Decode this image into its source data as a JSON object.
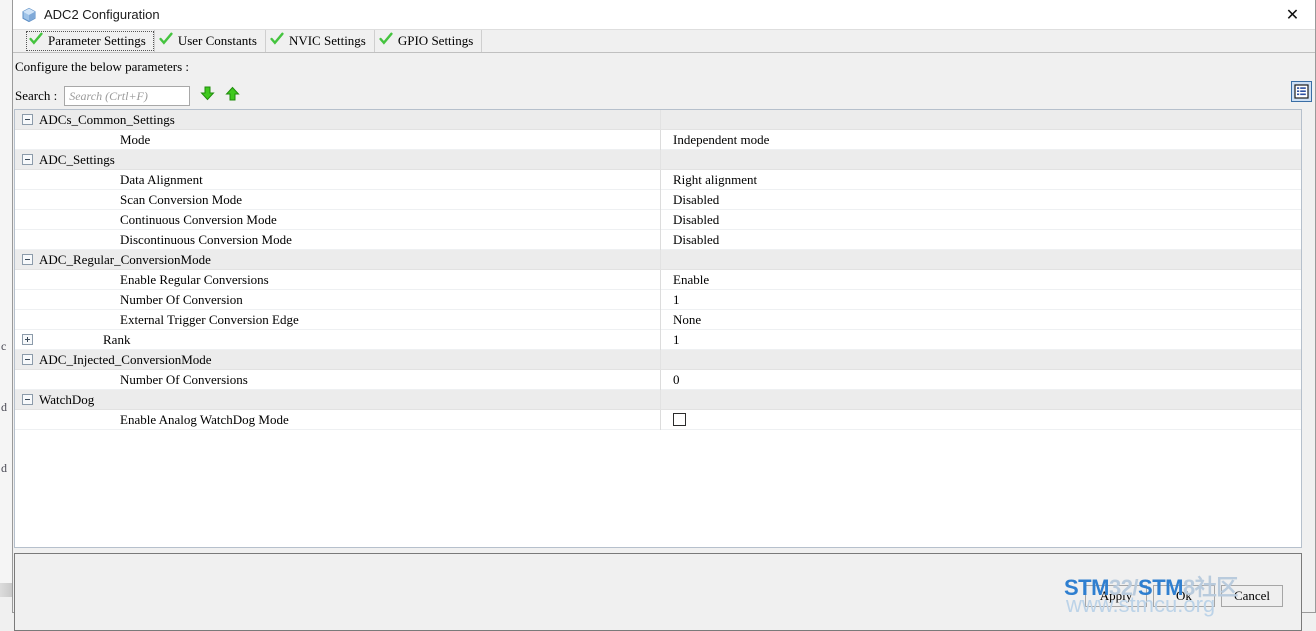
{
  "window": {
    "title": "ADC2 Configuration",
    "icon": "cube-icon",
    "close_label": "✕"
  },
  "tabs": [
    {
      "label": "Parameter Settings",
      "icon": "check-icon",
      "active": true
    },
    {
      "label": "User Constants",
      "icon": "check-icon",
      "active": false
    },
    {
      "label": "NVIC Settings",
      "icon": "check-icon",
      "active": false
    },
    {
      "label": "GPIO Settings",
      "icon": "check-icon",
      "active": false
    }
  ],
  "body": {
    "configure_text": "Configure the below parameters :",
    "search_label": "Search :",
    "search_value": "",
    "search_placeholder": "Search (Crtl+F)",
    "find_next_icon": "arrow-down-icon",
    "find_prev_icon": "arrow-up-icon",
    "list_view_icon": "list-view-icon"
  },
  "tree": [
    {
      "type": "group",
      "expander": "minus",
      "label": "ADCs_Common_Settings",
      "value": ""
    },
    {
      "type": "item",
      "expander": "none",
      "label": "Mode",
      "value": "Independent mode"
    },
    {
      "type": "group",
      "expander": "minus",
      "label": "ADC_Settings",
      "value": ""
    },
    {
      "type": "item",
      "expander": "none",
      "label": "Data Alignment",
      "value": "Right alignment"
    },
    {
      "type": "item",
      "expander": "none",
      "label": "Scan Conversion Mode",
      "value": "Disabled"
    },
    {
      "type": "item",
      "expander": "none",
      "label": "Continuous Conversion Mode",
      "value": "Disabled"
    },
    {
      "type": "item",
      "expander": "none",
      "label": "Discontinuous Conversion Mode",
      "value": "Disabled"
    },
    {
      "type": "group",
      "expander": "minus",
      "label": "ADC_Regular_ConversionMode",
      "value": ""
    },
    {
      "type": "item",
      "expander": "none",
      "label": "Enable Regular Conversions",
      "value": "Enable"
    },
    {
      "type": "item",
      "expander": "none",
      "label": "Number Of Conversion",
      "value": "1"
    },
    {
      "type": "item",
      "expander": "none",
      "label": "External Trigger Conversion Edge",
      "value": "None"
    },
    {
      "type": "rank",
      "expander": "plus",
      "label": "Rank",
      "value": "1"
    },
    {
      "type": "group",
      "expander": "minus",
      "label": "ADC_Injected_ConversionMode",
      "value": ""
    },
    {
      "type": "item",
      "expander": "none",
      "label": "Number Of Conversions",
      "value": "0"
    },
    {
      "type": "group",
      "expander": "minus",
      "label": "WatchDog",
      "value": ""
    },
    {
      "type": "checkbox",
      "expander": "none",
      "label": "Enable Analog WatchDog Mode",
      "value": "",
      "checked": false
    }
  ],
  "buttons": {
    "apply": "Apply",
    "ok": "Ok",
    "cancel": "Cancel"
  },
  "watermark": {
    "part1": "STM",
    "part2": "32/",
    "part3": "STM",
    "part4": "8社区",
    "line2": "www.stmcu.org"
  },
  "background": {
    "edge_letters": [
      "c",
      "d",
      "d"
    ]
  },
  "colors": {
    "accent": "#2f7fd0",
    "group_row": "#ececec",
    "tree_border": "#b6c0cc",
    "check_green": "#45b041"
  }
}
